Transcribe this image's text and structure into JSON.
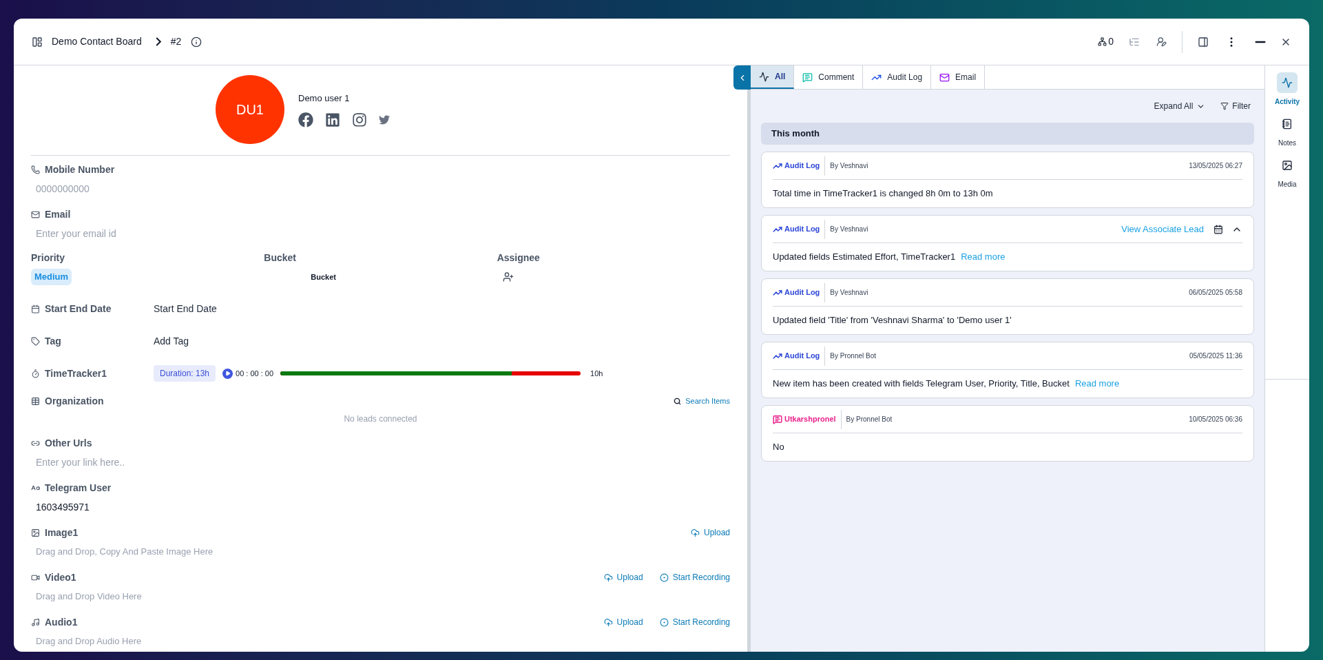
{
  "header": {
    "board": "Demo Contact Board",
    "item": "#2",
    "subitems_count": "0"
  },
  "profile": {
    "initials": "DU1",
    "name": "Demo user 1"
  },
  "fields": [
    {
      "kind": "input",
      "label": "Mobile Number",
      "placeholder": "0000000000"
    },
    {
      "kind": "input",
      "label": "Email",
      "placeholder": "Enter your email id"
    },
    {
      "kind": "meta",
      "columns": [
        {
          "label": "Priority",
          "value": "Medium"
        },
        {
          "label": "Bucket",
          "value": "Bucket"
        },
        {
          "label": "Assignee"
        }
      ]
    },
    {
      "kind": "inline",
      "label": "Start End Date",
      "value": "Start End Date"
    },
    {
      "kind": "inline",
      "label": "Tag",
      "value": "Add Tag"
    },
    {
      "kind": "timer",
      "label": "TimeTracker1",
      "duration": "Duration: 13h",
      "time": "00 : 00 : 00",
      "level": 0.77,
      "total": "10h"
    },
    {
      "kind": "relation",
      "label": "Organization",
      "action": "Search Items",
      "empty": "No leads connected"
    },
    {
      "kind": "input",
      "label": "Other Urls",
      "placeholder": "Enter your link here.."
    },
    {
      "kind": "value",
      "label": "Telegram User",
      "value": "1603495971"
    },
    {
      "kind": "media",
      "label": "Image1",
      "actions": [
        "Upload"
      ],
      "hint": "Drag and Drop, Copy And Paste Image Here"
    },
    {
      "kind": "media",
      "label": "Video1",
      "actions": [
        "Upload",
        "Start Recording"
      ],
      "hint": "Drag and Drop Video Here"
    },
    {
      "kind": "media",
      "label": "Audio1",
      "actions": [
        "Upload",
        "Start Recording"
      ],
      "hint": "Drag and Drop Audio Here"
    }
  ],
  "activity": {
    "tabs": [
      {
        "label": "All",
        "selected": true
      },
      {
        "label": "Comment",
        "selected": false
      },
      {
        "label": "Audit Log",
        "selected": false
      },
      {
        "label": "Email",
        "selected": false
      }
    ],
    "expand": "Expand All",
    "filter": "Filter",
    "group": "This month",
    "entries": [
      {
        "kind": "audit",
        "source": "Audit Log",
        "by": "By Veshnavi",
        "date": "13/05/2025 06:27",
        "text": "Total time in TimeTracker1 is changed 8h 0m to 13h 0m"
      },
      {
        "kind": "audit",
        "source": "Audit Log",
        "by": "By Veshnavi",
        "action": "View Associate Lead",
        "text": "Updated fields Estimated Effort, TimeTracker1",
        "more": "Read more"
      },
      {
        "kind": "audit",
        "source": "Audit Log",
        "by": "By Veshnavi",
        "date": "06/05/2025 05:58",
        "text": "Updated field 'Title' from 'Veshnavi Sharma' to 'Demo user 1'"
      },
      {
        "kind": "audit",
        "source": "Audit Log",
        "by": "By Pronnel Bot",
        "date": "05/05/2025 11:36",
        "text": "New item has been created with fields Telegram User, Priority, Title, Bucket",
        "more": "Read more"
      },
      {
        "kind": "comment",
        "source": "Utkarshpronel",
        "by": "By Pronnel Bot",
        "date": "10/05/2025 06:36",
        "text": "No"
      }
    ]
  },
  "rail": [
    {
      "label": "Activity",
      "selected": true
    },
    {
      "label": "Notes",
      "selected": false
    },
    {
      "label": "Media",
      "selected": false
    }
  ]
}
